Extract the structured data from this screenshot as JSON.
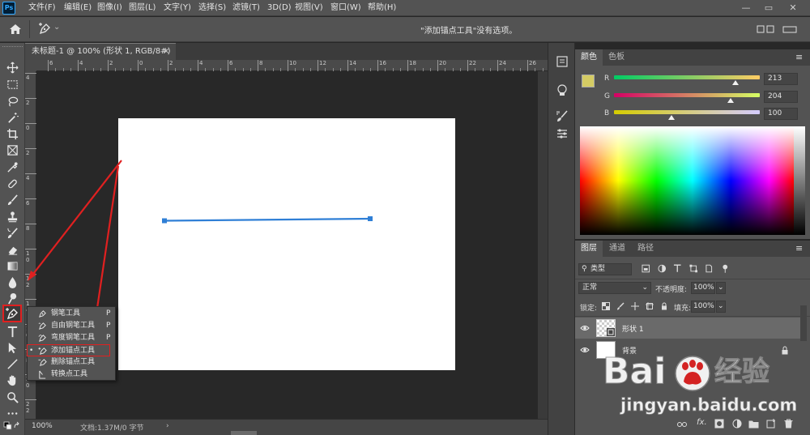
{
  "app": {
    "logo_text": "Ps"
  },
  "menu": {
    "items": [
      "文件(F)",
      "编辑(E)",
      "图像(I)",
      "图层(L)",
      "文字(Y)",
      "选择(S)",
      "滤镜(T)",
      "3D(D)",
      "视图(V)",
      "窗口(W)",
      "帮助(H)"
    ]
  },
  "window_controls": {
    "minimize": "—",
    "restore": "▭",
    "close": "✕"
  },
  "options_bar": {
    "home_icon": "home-icon",
    "tool_icon": "add-anchor-pen-icon",
    "dropdown_caret": "⌄",
    "hint": "\"添加锚点工具\"没有选项。"
  },
  "document": {
    "tab_title": "未标题-1 @ 100% (形状 1, RGB/8#) *",
    "close_glyph": "×",
    "ruler_h_ticks": [
      "6",
      "4",
      "2",
      "0",
      "2",
      "4",
      "6",
      "8",
      "10",
      "12",
      "14",
      "16",
      "18",
      "20",
      "22",
      "24",
      "26"
    ],
    "ruler_v_ticks": [
      "4",
      "2",
      "0",
      "2",
      "4",
      "6",
      "8",
      "10",
      "12",
      "14",
      "16",
      "18",
      "20",
      "22"
    ],
    "zoom": "100%",
    "doc_info": "文档:1.37M/0 字节",
    "status_arrow": "›"
  },
  "toolbar": {
    "tools": [
      "move-icon",
      "marquee-icon",
      "lasso-icon",
      "magic-wand-icon",
      "crop-icon",
      "frame-icon",
      "eyedropper-icon",
      "healing-brush-icon",
      "brush-icon",
      "clone-stamp-icon",
      "history-brush-icon",
      "eraser-icon",
      "gradient-icon",
      "blur-icon",
      "dodge-icon",
      "add-anchor-pen-icon",
      "type-icon",
      "path-selection-icon",
      "line-icon",
      "hand-icon",
      "zoom-icon",
      "more-icon"
    ]
  },
  "pen_flyout": {
    "items": [
      {
        "label": "钢笔工具",
        "key": "P",
        "icon": "pen-icon",
        "selected": false
      },
      {
        "label": "自由钢笔工具",
        "key": "P",
        "icon": "freeform-pen-icon",
        "selected": false
      },
      {
        "label": "弯度钢笔工具",
        "key": "P",
        "icon": "curvature-pen-icon",
        "selected": false
      },
      {
        "label": "添加锚点工具",
        "key": "",
        "icon": "add-anchor-point-icon",
        "selected": true
      },
      {
        "label": "删除锚点工具",
        "key": "",
        "icon": "delete-anchor-point-icon",
        "selected": false
      },
      {
        "label": "转换点工具",
        "key": "",
        "icon": "convert-point-icon",
        "selected": false
      }
    ],
    "bullet": "•"
  },
  "color_panel": {
    "tabs": [
      "颜色",
      "色板"
    ],
    "menu_glyph": "≡",
    "foreground": "#d5cc64",
    "background": "#ffffff",
    "channels": [
      {
        "label": "R",
        "value": "213",
        "fraction": 0.835
      },
      {
        "label": "G",
        "value": "204",
        "fraction": 0.8
      },
      {
        "label": "B",
        "value": "100",
        "fraction": 0.392
      }
    ]
  },
  "layers_panel": {
    "tabs": [
      "图层",
      "通道",
      "路径"
    ],
    "menu_glyph": "≡",
    "filter_label": "类型",
    "blend_mode": "正常",
    "opacity_label": "不透明度:",
    "opacity_value": "100%",
    "lock_label": "锁定:",
    "fill_label": "填充:",
    "fill_value": "100%",
    "layers": [
      {
        "name": "形状 1",
        "selected": true,
        "locked": false
      },
      {
        "name": "背景",
        "selected": false,
        "locked": true
      }
    ],
    "footer_icons": [
      "link-icon",
      "fx-icon",
      "mask-icon",
      "adjustment-icon",
      "group-icon",
      "new-layer-icon",
      "trash-icon"
    ],
    "fx_label": "fx."
  },
  "watermark": {
    "brand": "Bai",
    "brand_tail": "经验",
    "url": "jingyan.baidu.com"
  },
  "colors": {
    "accent": "#31a8ff",
    "path": "#2f7fd6",
    "highlight": "#e02020"
  }
}
